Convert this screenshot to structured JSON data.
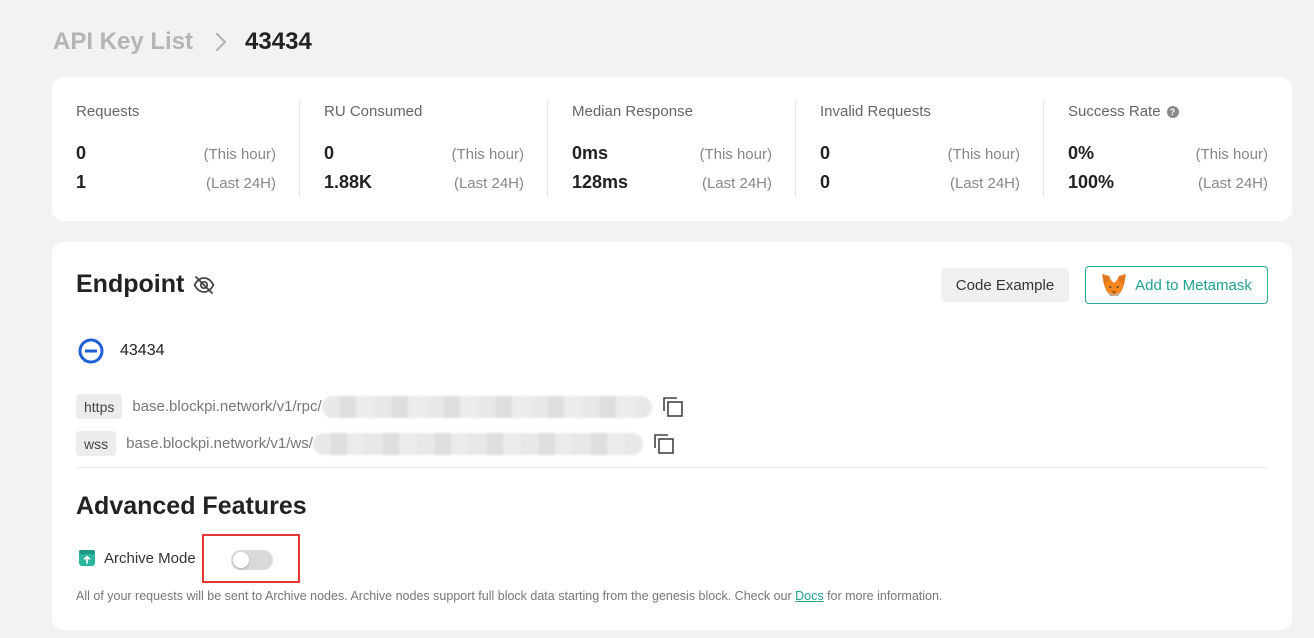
{
  "breadcrumb": {
    "parent": "API Key List",
    "current": "43434"
  },
  "stats": [
    {
      "title": "Requests",
      "hour_value": "0",
      "day_value": "1",
      "hour_label": "(This hour)",
      "day_label": "(Last 24H)"
    },
    {
      "title": "RU Consumed",
      "hour_value": "0",
      "day_value": "1.88K",
      "hour_label": "(This hour)",
      "day_label": "(Last 24H)"
    },
    {
      "title": "Median Response",
      "hour_value": "0ms",
      "day_value": "128ms",
      "hour_label": "(This hour)",
      "day_label": "(Last 24H)"
    },
    {
      "title": "Invalid Requests",
      "hour_value": "0",
      "day_value": "0",
      "hour_label": "(This hour)",
      "day_label": "(Last 24H)"
    },
    {
      "title": "Success Rate",
      "hour_value": "0%",
      "day_value": "100%",
      "hour_label": "(This hour)",
      "day_label": "(Last 24H)",
      "help_icon": "?"
    }
  ],
  "endpoint": {
    "title": "Endpoint",
    "code_example_label": "Code Example",
    "metamask_label": "Add to Metamask",
    "chain_label": "43434",
    "https": {
      "protocol": "https",
      "url": "base.blockpi.network/v1/rpc/"
    },
    "wss": {
      "protocol": "wss",
      "url": "base.blockpi.network/v1/ws/"
    }
  },
  "advanced": {
    "title": "Advanced Features",
    "archive_label": "Archive Mode",
    "archive_enabled": false,
    "desc_before": "All of your requests will be sent to Archive nodes. Archive nodes support full block data starting from the genesis block. Check our ",
    "docs_link": "Docs",
    "desc_after": " for more information."
  },
  "colors": {
    "accent": "#20a091",
    "chain_blue": "#1f5fd6",
    "highlight": "#e53935"
  }
}
